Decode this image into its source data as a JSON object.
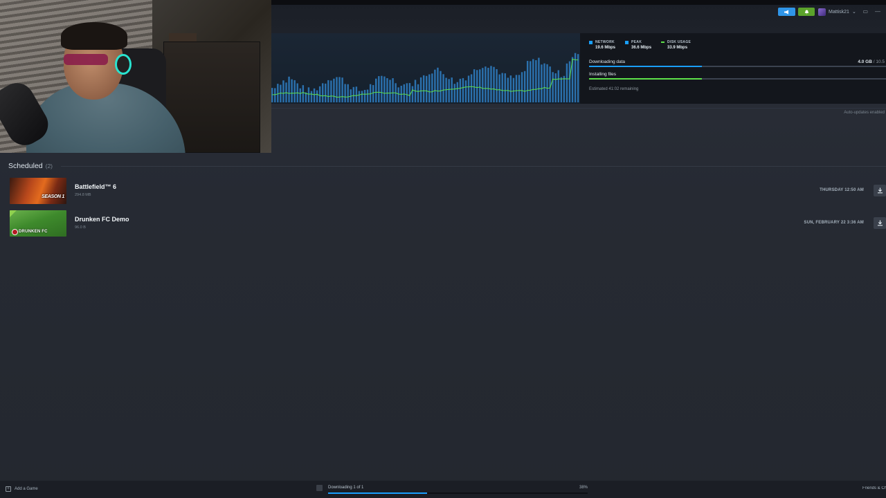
{
  "topbar": {
    "username": "Mattisk21",
    "icons": [
      "megaphone-icon",
      "bell-icon",
      "monitor-icon",
      "minimize-icon"
    ]
  },
  "download_stats": {
    "network_label": "NETWORK",
    "network_value": "19.6 Mbps",
    "peak_label": "PEAK",
    "peak_value": "36.6 Mbps",
    "disk_label": "DISK USAGE",
    "disk_value": "33.9 Mbps",
    "colors": {
      "network": "#1a9fff",
      "peak": "#1a9fff",
      "disk": "#5ee24a"
    }
  },
  "progress": {
    "downloading_label": "Downloading data",
    "downloaded": "4.0 GB",
    "total": "/ 10.5",
    "downloading_fraction": 0.38,
    "installing_label": "Installing files",
    "installing_fraction": 0.38,
    "estimated": "Estimated 41:02 remaining"
  },
  "auto_updates": "Auto-updates enabled",
  "scheduled": {
    "title": "Scheduled",
    "count": "(2)",
    "items": [
      {
        "name": "Battlefield™ 6",
        "size": "294.8 MB",
        "time": "THURSDAY 12:50 AM",
        "thumb_tag": "SEASON 1"
      },
      {
        "name": "Drunken FC Demo",
        "size": "96.0 B",
        "time": "SUN, FEBRUARY 22 3:36 AM",
        "thumb_tag": "DRUNKEN FC"
      }
    ]
  },
  "bottombar": {
    "add_game": "Add a Game",
    "downloading_label": "Downloading 1 of 1",
    "percent": "38%",
    "percent_fraction": 0.38,
    "friends": "Friends & Chat"
  }
}
